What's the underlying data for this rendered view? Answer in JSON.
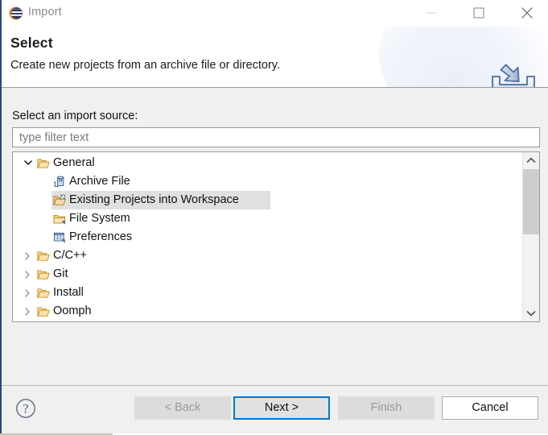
{
  "window": {
    "title": "Import",
    "app_icon": "eclipse-icon",
    "controls": {
      "minimize": "minimize-icon",
      "maximize": "maximize-icon",
      "close": "close-icon"
    }
  },
  "header": {
    "title": "Select",
    "description": "Create new projects from an archive file or directory.",
    "banner_icon": "import-tray-arrow-icon"
  },
  "main": {
    "source_label": "Select an import source:",
    "filter": {
      "value": "",
      "placeholder": "type filter text"
    },
    "tree": [
      {
        "label": "General",
        "icon": "open-folder-icon",
        "expanded": true,
        "depth": 0,
        "selected": false,
        "has_twisty": true
      },
      {
        "label": "Archive File",
        "icon": "archive-file-icon",
        "expanded": null,
        "depth": 1,
        "selected": false,
        "has_twisty": false
      },
      {
        "label": "Existing Projects into Workspace",
        "icon": "open-folder-green-arrow-icon",
        "expanded": null,
        "depth": 1,
        "selected": true,
        "has_twisty": false
      },
      {
        "label": "File System",
        "icon": "closed-folder-icon",
        "expanded": null,
        "depth": 1,
        "selected": false,
        "has_twisty": false
      },
      {
        "label": "Preferences",
        "icon": "preferences-grid-icon",
        "expanded": null,
        "depth": 1,
        "selected": false,
        "has_twisty": false
      },
      {
        "label": "C/C++",
        "icon": "open-folder-icon",
        "expanded": false,
        "depth": 0,
        "selected": false,
        "has_twisty": true
      },
      {
        "label": "Git",
        "icon": "open-folder-icon",
        "expanded": false,
        "depth": 0,
        "selected": false,
        "has_twisty": true
      },
      {
        "label": "Install",
        "icon": "open-folder-icon",
        "expanded": false,
        "depth": 0,
        "selected": false,
        "has_twisty": true
      },
      {
        "label": "Oomph",
        "icon": "open-folder-icon",
        "expanded": false,
        "depth": 0,
        "selected": false,
        "has_twisty": true
      }
    ],
    "scrollbar": {
      "up_icon": "chevron-up-icon",
      "down_icon": "chevron-down-icon"
    }
  },
  "footer": {
    "help_icon": "help-question-icon",
    "buttons": [
      {
        "label": "< Back",
        "state": "disabled"
      },
      {
        "label": "Next >",
        "state": "default"
      },
      {
        "label": "Finish",
        "state": "disabled"
      },
      {
        "label": "Cancel",
        "state": "enabled"
      }
    ]
  },
  "colors": {
    "accent": "#0078d7",
    "window_bg": "#f0f0f0",
    "selection": "#e0e0e0",
    "folder": "#e8a33d",
    "title_border": "#2b4580"
  }
}
